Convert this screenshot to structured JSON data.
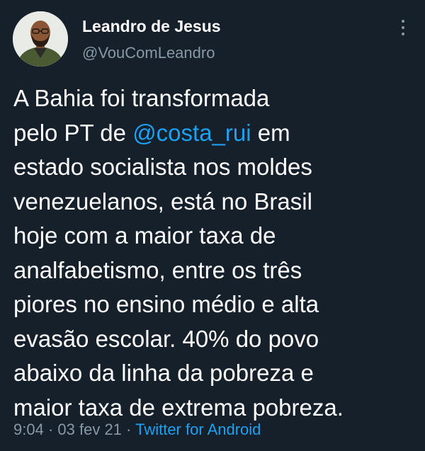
{
  "author": {
    "display_name": "Leandro de Jesus",
    "handle": "@VouComLeandro"
  },
  "more_icon": "vertical-ellipsis-icon",
  "tweet": {
    "lines": [
      [
        "A Bahia foi transformada"
      ],
      [
        "pelo PT de ",
        "@costa_rui",
        " em"
      ],
      [
        "estado socialista nos moldes"
      ],
      [
        "venezuelanos, está no Brasil"
      ],
      [
        "hoje com a maior taxa de"
      ],
      [
        "analfabetismo, entre os três"
      ],
      [
        "piores no ensino médio e alta"
      ],
      [
        "evasão escolar. 40% do povo"
      ],
      [
        "abaixo da linha da pobreza e"
      ],
      [
        "maior taxa de extrema pobreza."
      ]
    ]
  },
  "meta": {
    "time": "9:04",
    "separator": "·",
    "date": "03 fev 21",
    "source": "Twitter for Android"
  },
  "colors": {
    "background": "#15202b",
    "text": "#ffffff",
    "secondary": "#8899a6",
    "accent": "#1da1f2"
  }
}
